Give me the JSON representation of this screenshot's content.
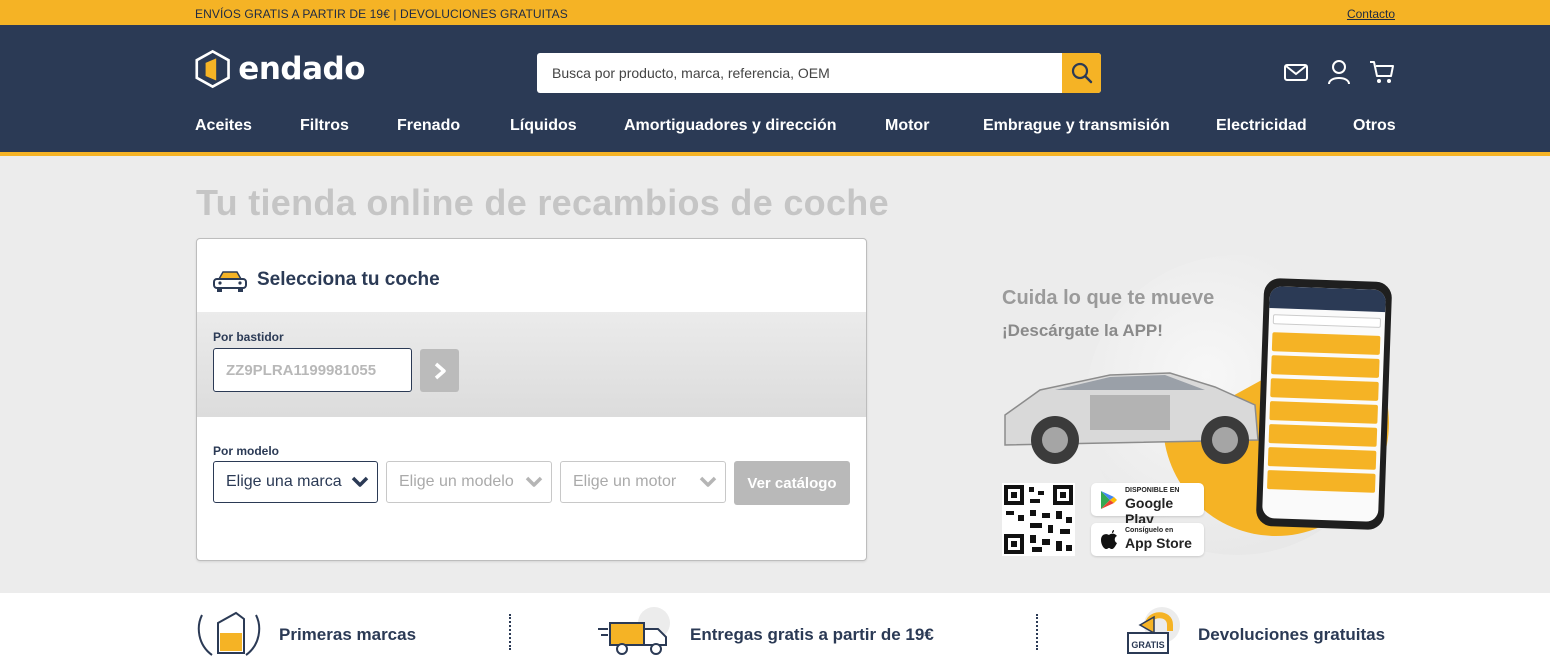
{
  "topbar": {
    "promo": "ENVÍOS GRATIS A PARTIR DE 19€ | DEVOLUCIONES GRATUITAS",
    "contact": "Contacto"
  },
  "header": {
    "logo_text": "endado",
    "search_placeholder": "Busca por producto, marca, referencia, OEM",
    "icons": [
      "mail-icon",
      "user-icon",
      "cart-icon",
      "search-icon"
    ]
  },
  "nav": {
    "items": [
      "Aceites",
      "Filtros",
      "Frenado",
      "Líquidos",
      "Amortiguadores y dirección",
      "Motor",
      "Embrague y transmisión",
      "Electricidad",
      "Otros"
    ]
  },
  "hero": {
    "title": "Tu tienda online de recambios de coche"
  },
  "selector": {
    "title": "Selecciona tu coche",
    "vin_label": "Por bastidor",
    "vin_placeholder": "ZZ9PLRA1199981055",
    "model_label": "Por modelo",
    "brand_select": "Elige una marca",
    "model_select": "Elige un modelo",
    "engine_select": "Elige un motor",
    "catalog_button": "Ver catálogo"
  },
  "app_promo": {
    "headline": "Cuida lo que te mueve",
    "subheadline": "¡Descárgate la APP!",
    "google_small": "DISPONIBLE EN",
    "google_large": "Google Play",
    "apple_small": "Consíguelo en",
    "apple_large": "App Store"
  },
  "features": {
    "items": [
      "Primeras marcas",
      "Entregas gratis a partir de 19€",
      "Devoluciones gratuitas"
    ],
    "badge": "GRATIS"
  },
  "colors": {
    "accent": "#f5b325",
    "navy": "#2b3a55",
    "background": "#ececec"
  }
}
